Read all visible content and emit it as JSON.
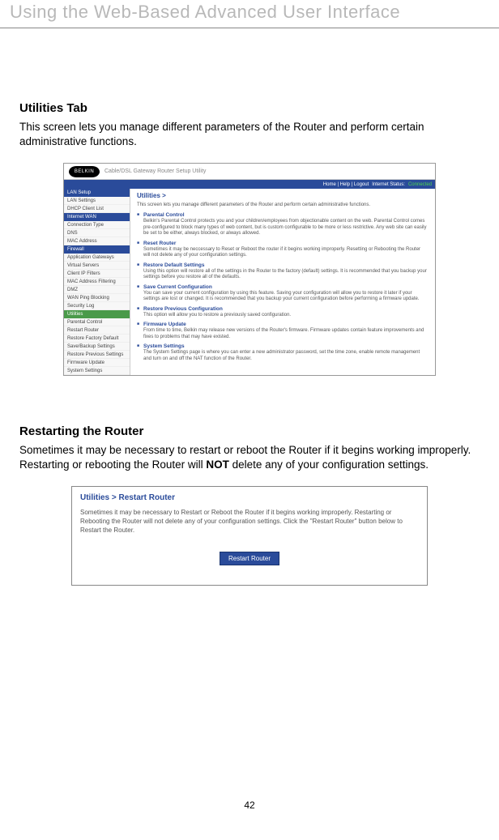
{
  "header": "Using the Web-Based Advanced User Interface",
  "section1": {
    "title": "Utilities Tab",
    "desc": "This screen lets you manage different parameters of the Router and perform certain administrative functions."
  },
  "shot1": {
    "logo": "BELKIN",
    "logo_sub": "Cable/DSL Gateway Router Setup Utility",
    "topbar": {
      "links": "Home | Help | Logout",
      "status_label": "Internet Status:",
      "status": "Connected"
    },
    "sidebar": {
      "groups": [
        {
          "head": "LAN Setup",
          "items": [
            "LAN Settings",
            "DHCP Client List"
          ]
        },
        {
          "head": "Internet WAN",
          "items": [
            "Connection Type",
            "DNS",
            "MAC Address"
          ]
        },
        {
          "head": "Firewall",
          "items": [
            "Application Gateways",
            "Virtual Servers",
            "Client IP Filters",
            "MAC Address Filtering",
            "DMZ",
            "WAN Ping Blocking",
            "Security Log"
          ]
        },
        {
          "head": "Utilities",
          "green": true,
          "items": [
            "Parental Control",
            "Restart Router",
            "Restore Factory Default",
            "Save/Backup Settings",
            "Restore Previous Settings",
            "Firmware Update",
            "System Settings"
          ]
        }
      ]
    },
    "main": {
      "title": "Utilities >",
      "intro": "This screen lets you manage different parameters of the Router and perform certain administrative functions.",
      "items": [
        {
          "t": "Parental Control",
          "d": "Belkin's Parental Control protects you and your children/employees from objectionable content on the web. Parental Control comes pre-configured to block many types of web content, but is custom configurable to be more or less restrictive. Any web site can easily be set to be either, always blocked, or always allowed."
        },
        {
          "t": "Reset Router",
          "d": "Sometimes it may be neccessary to Reset or Reboot the router if it begins working improperly. Resetting or Rebooting the Router will not delete any of your configuration settings."
        },
        {
          "t": "Restore Default Settings",
          "d": "Using this option will restore all of the settings in the Router to the factory (default) settings. It is recommended that you backup your settings before you restore all of the defaults."
        },
        {
          "t": "Save Current Configuration",
          "d": "You can save your current configuration by using this feature. Saving your configuration will allow you to restore it later if your settings are lost or changed. It is recommended that you backup your current configuration before performing a firmware update."
        },
        {
          "t": "Restore Previous Configuration",
          "d": "This option will allow you to restore a previously saved configuration."
        },
        {
          "t": "Firmware Update",
          "d": "From time to time, Belkin may release new versions of the Router's firmware. Firmware updates contain feature improvements and fixes to problems that may have existed."
        },
        {
          "t": "System Settings",
          "d": "The System Settings page is where you can enter a new administrator password, set the time zone, enable remote management and turn on and off the NAT function of the Router."
        }
      ]
    }
  },
  "section2": {
    "title": "Restarting the Router",
    "desc_pre": "Sometimes it may be necessary to restart or reboot the Router if it begins working improperly. Restarting or rebooting the Router will ",
    "desc_bold": "NOT",
    "desc_post": " delete any of your configuration settings."
  },
  "shot2": {
    "title": "Utilities > Restart Router",
    "desc": "Sometimes it may be necessary to Restart or Reboot the Router if it begins working improperly. Restarting or Rebooting the Router will not delete any of your configuration settings. Click the \"Restart Router\" button below to Restart the Router.",
    "button": "Restart Router"
  },
  "page_number": "42"
}
